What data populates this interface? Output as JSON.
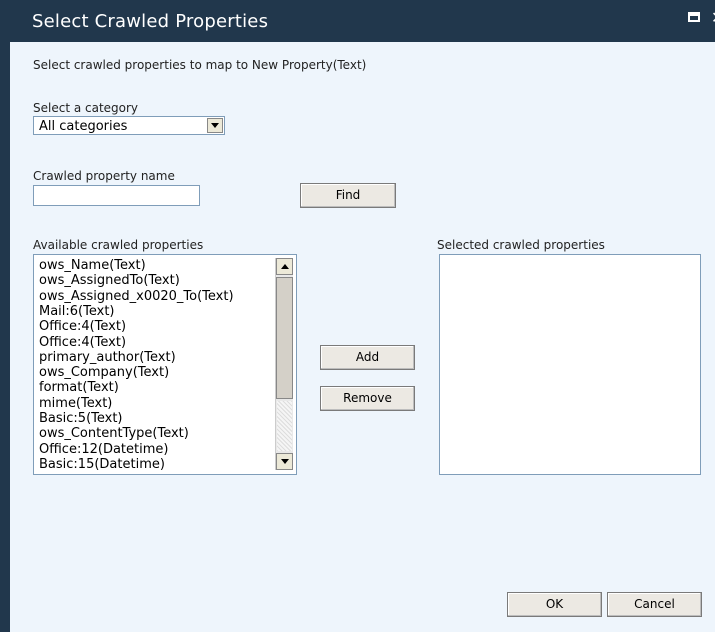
{
  "window": {
    "title": "Select Crawled Properties",
    "maximize_icon": "maximize-icon",
    "close_glyph": "✕"
  },
  "instruction": "Select crawled properties to map to New Property(Text)",
  "category": {
    "label": "Select a category",
    "selected": "All categories"
  },
  "search": {
    "label": "Crawled property name",
    "value": "",
    "find_label": "Find"
  },
  "available": {
    "label": "Available crawled properties",
    "items": [
      "ows_Name(Text)",
      "ows_AssignedTo(Text)",
      "ows_Assigned_x0020_To(Text)",
      "Mail:6(Text)",
      "Office:4(Text)",
      "Office:4(Text)",
      "primary_author(Text)",
      "ows_Company(Text)",
      "format(Text)",
      "mime(Text)",
      "Basic:5(Text)",
      "ows_ContentType(Text)",
      "Office:12(Datetime)",
      "Basic:15(Datetime)"
    ]
  },
  "actions": {
    "add_label": "Add",
    "remove_label": "Remove"
  },
  "selected": {
    "label": "Selected crawled properties",
    "items": []
  },
  "footer": {
    "ok_label": "OK",
    "cancel_label": "Cancel"
  },
  "colors": {
    "titlebar": "#21374c",
    "background": "#eef5fc"
  }
}
